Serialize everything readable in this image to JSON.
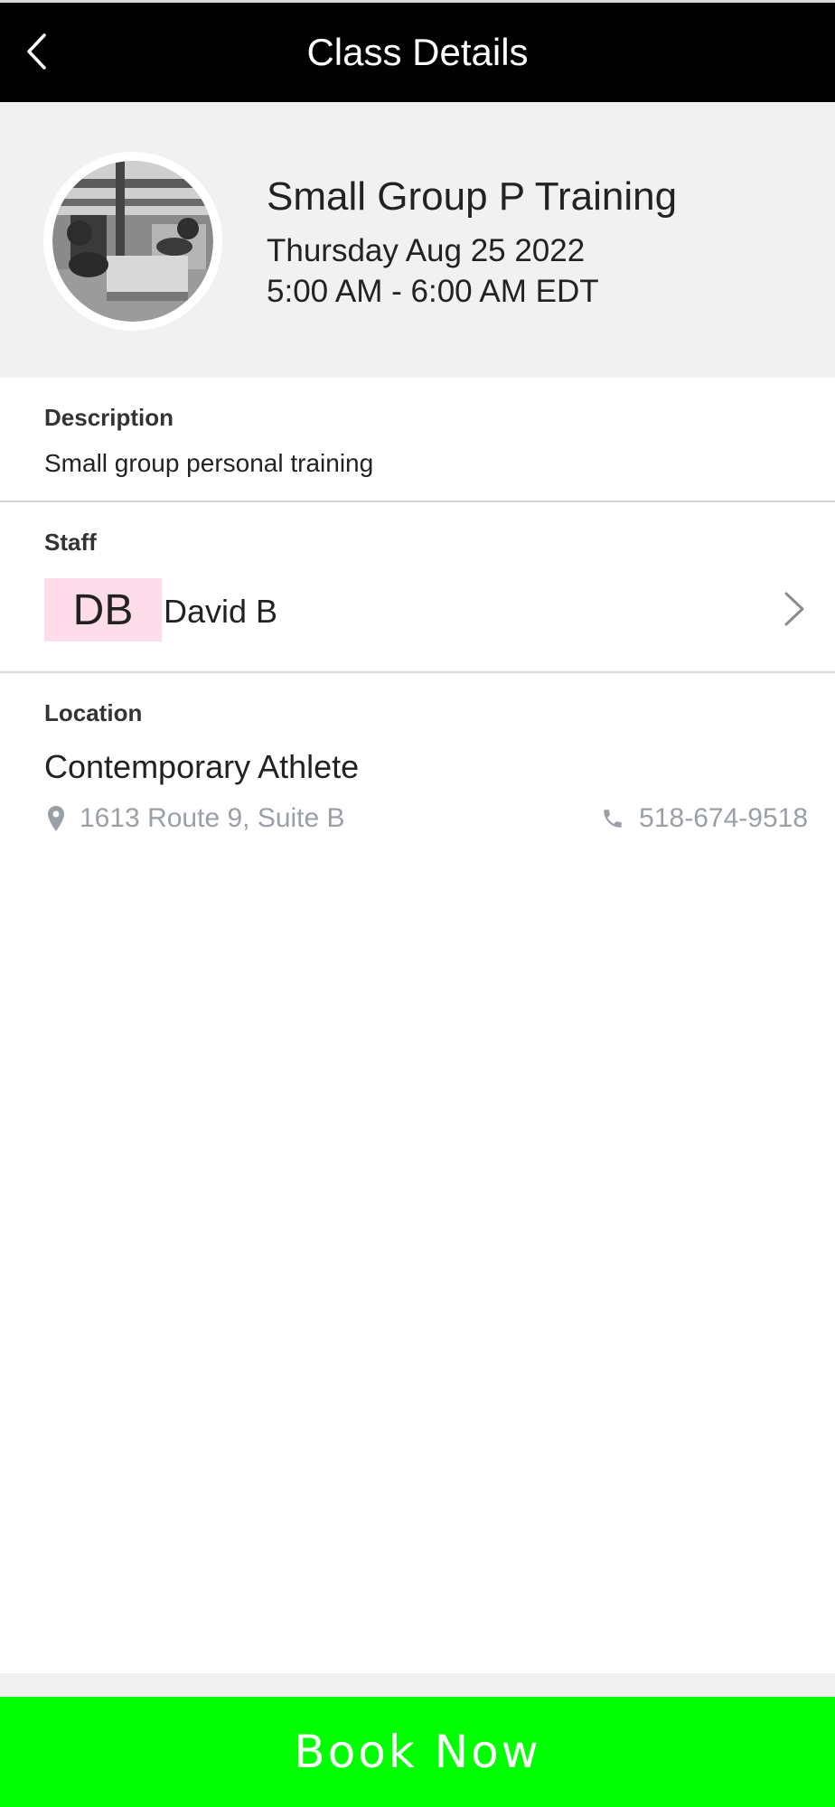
{
  "header": {
    "title": "Class Details",
    "back_icon": "chevron-left-icon"
  },
  "class": {
    "name": "Small Group P Training",
    "date": "Thursday Aug 25 2022",
    "time": "5:00 AM - 6:00 AM EDT"
  },
  "description": {
    "label": "Description",
    "text": "Small group personal training"
  },
  "staff": {
    "label": "Staff",
    "initials": "DB",
    "name": "David B",
    "badge_color": "#ffdcea"
  },
  "location": {
    "label": "Location",
    "name": "Contemporary Athlete",
    "address": "1613 Route 9, Suite B",
    "phone": "518-674-9518",
    "address_icon": "map-pin-icon",
    "phone_icon": "phone-icon"
  },
  "actions": {
    "book_label": "Book Now",
    "book_color": "#00ff00"
  }
}
